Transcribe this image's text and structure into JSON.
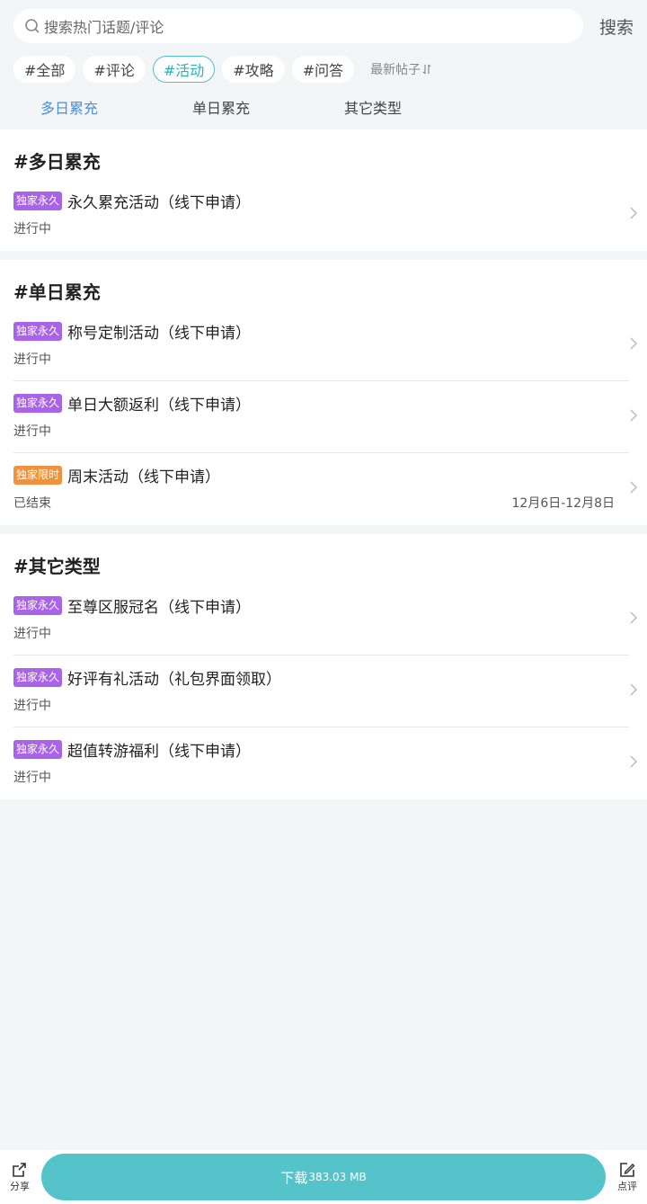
{
  "search": {
    "placeholder": "搜索热门话题/评论",
    "button": "搜索"
  },
  "tags": [
    "#全部",
    "#评论",
    "#活动",
    "#攻略",
    "#问答"
  ],
  "sort_label": "最新帖子",
  "tabs": [
    "多日累充",
    "单日累充",
    "其它类型"
  ],
  "sections": [
    {
      "title": "#多日累充",
      "items": [
        {
          "badge": "独家永久",
          "title": "永久累充活动（线下申请）",
          "status": "进行中",
          "date": ""
        }
      ]
    },
    {
      "title": "#单日累充",
      "items": [
        {
          "badge": "独家永久",
          "title": "称号定制活动（线下申请）",
          "status": "进行中",
          "date": ""
        },
        {
          "badge": "独家永久",
          "title": "单日大额返利（线下申请）",
          "status": "进行中",
          "date": ""
        },
        {
          "badge": "独家限时",
          "title": "周末活动（线下申请）",
          "status": "已结束",
          "date": "12月6日-12月8日"
        }
      ]
    },
    {
      "title": "#其它类型",
      "items": [
        {
          "badge": "独家永久",
          "title": "至尊区服冠名（线下申请）",
          "status": "进行中",
          "date": ""
        },
        {
          "badge": "独家永久",
          "title": "好评有礼活动（礼包界面领取）",
          "status": "进行中",
          "date": ""
        },
        {
          "badge": "独家永久",
          "title": "超值转游福利（线下申请）",
          "status": "进行中",
          "date": ""
        }
      ]
    }
  ],
  "bottom": {
    "share": "分享",
    "download": "下载",
    "size": "383.03 MB",
    "review": "点评"
  },
  "colors": {
    "accent": "#55c4ca",
    "badge_purple": "#a863e6",
    "badge_orange": "#f0923b",
    "tab_active": "#4a90d9"
  }
}
